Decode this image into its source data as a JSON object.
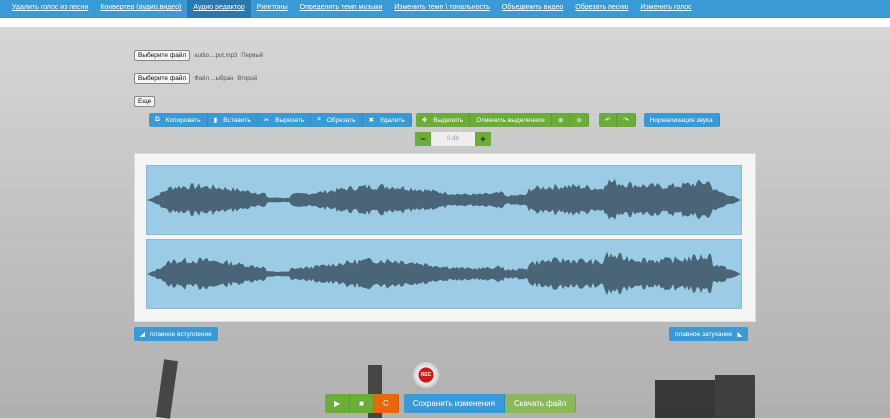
{
  "nav": {
    "items": [
      "Удалить голос из песни",
      "Конвертер (аудио,видео)",
      "Аудио редактор",
      "Рингтоны",
      "Определить темп музыки",
      "Изменить темп \\ тональность",
      "Объединить видео",
      "Обрезать песню",
      "Изменить голос"
    ],
    "active": 2
  },
  "files": [
    {
      "button": "Выберите файл",
      "name": "audio....put.mp3",
      "label": "Первый"
    },
    {
      "button": "Выберите файл",
      "name": "Файл ...ыбран",
      "label": "Второй"
    }
  ],
  "more_label": "Еще",
  "toolbar": {
    "copy": "Копировать",
    "paste": "Вставить",
    "cut": "Вырезать",
    "crop": "Обрезать",
    "delete": "Удалить",
    "select": "Выделить",
    "deselect": "Отменить выделенное",
    "normalize": "Нормализация звука"
  },
  "volume": {
    "minus": "−",
    "value": "0 db",
    "plus": "+"
  },
  "fade_in": "плавное вступление",
  "fade_out": "плавное затухание",
  "rec_label": "REC",
  "controls": {
    "play": "▶",
    "stop": "■",
    "loop": "C",
    "save": "Сохранить изменения",
    "download": "Скачать файл"
  },
  "colors": {
    "accent": "#3a9ad6",
    "green": "#6aad3a",
    "orange": "#e8660c",
    "wave": "#4a6577",
    "wave_bg": "#9ccbe6"
  }
}
